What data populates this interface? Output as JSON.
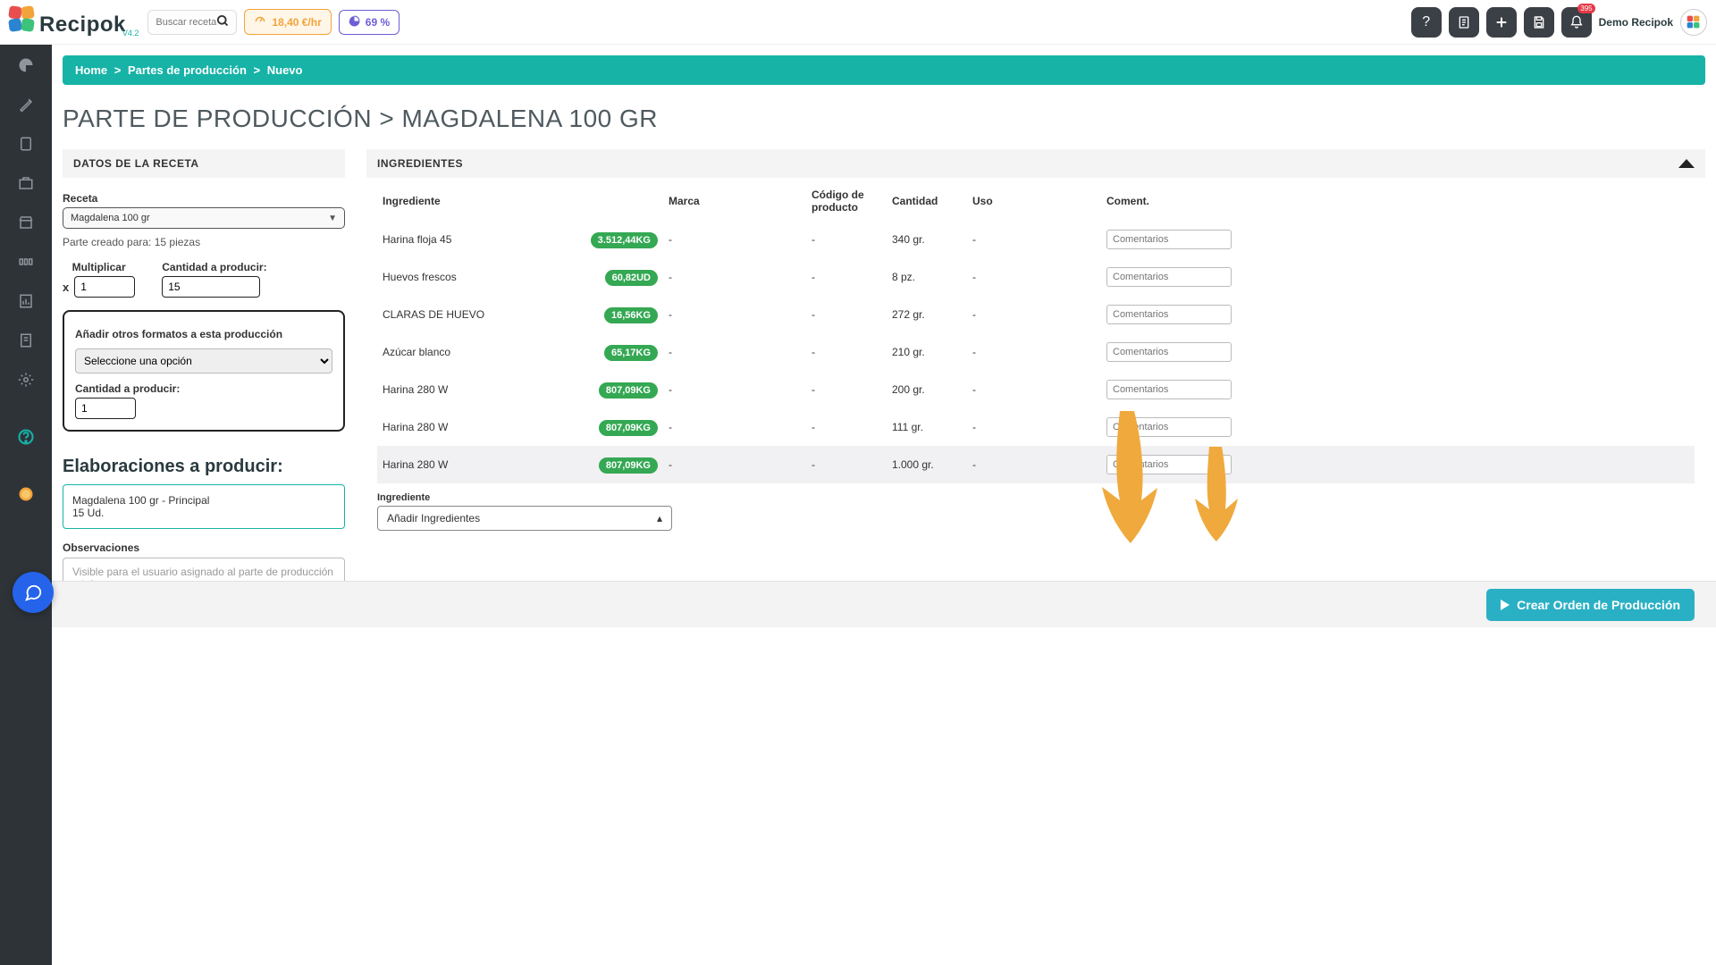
{
  "top": {
    "logo_text": "Recipok",
    "version": "V4.2",
    "search_placeholder": "Buscar recetas..",
    "metric_price": "18,40 €/hr",
    "metric_pct": "69 %",
    "notif_badge": "395",
    "user_name": "Demo Recipok"
  },
  "breadcrumb": {
    "home": "Home",
    "sep": ">",
    "partes": "Partes de producción",
    "nuevo": "Nuevo"
  },
  "page_title": "PARTE DE PRODUCCIÓN > MAGDALENA 100 GR",
  "recipe_panel": {
    "header": "DATOS DE LA RECETA",
    "recipe_label": "Receta",
    "recipe_value": "Magdalena 100 gr",
    "created_for": "Parte creado para: 15 piezas",
    "mult_label": "Multiplicar",
    "mult_value": "1",
    "qty_label": "Cantidad a producir:",
    "qty_value": "15",
    "addfmt_title": "Añadir otros formatos a esta producción",
    "addfmt_placeholder": "Seleccione una opción",
    "addfmt_qty_label": "Cantidad a producir:",
    "addfmt_qty_value": "1",
    "elab_header": "Elaboraciones a producir:",
    "elab_line1": "Magdalena 100 gr - Principal",
    "elab_line2": "15 Ud.",
    "obs_label": "Observaciones",
    "obs_placeholder": "Visible para el usuario asignado al parte de producción e informes"
  },
  "ingredients_panel": {
    "header": "INGREDIENTES",
    "cols": {
      "ingrediente": "Ingrediente",
      "marca": "Marca",
      "codigo": "Código de producto",
      "cantidad": "Cantidad",
      "uso": "Uso",
      "coment": "Coment."
    },
    "rows": [
      {
        "name": "Harina floja 45",
        "stock": "3.512,44KG",
        "marca": "-",
        "codigo": "-",
        "cant": "340 gr.",
        "uso": "-"
      },
      {
        "name": "Huevos frescos",
        "stock": "60,82UD",
        "marca": "-",
        "codigo": "-",
        "cant": "8 pz.",
        "uso": "-"
      },
      {
        "name": "CLARAS DE HUEVO",
        "stock": "16,56KG",
        "marca": "-",
        "codigo": "-",
        "cant": "272 gr.",
        "uso": "-"
      },
      {
        "name": "Azúcar blanco",
        "stock": "65,17KG",
        "marca": "-",
        "codigo": "-",
        "cant": "210 gr.",
        "uso": "-"
      },
      {
        "name": "Harina 280 W",
        "stock": "807,09KG",
        "marca": "-",
        "codigo": "-",
        "cant": "200 gr.",
        "uso": "-"
      },
      {
        "name": "Harina 280 W",
        "stock": "807,09KG",
        "marca": "-",
        "codigo": "-",
        "cant": "111 gr.",
        "uso": "-"
      },
      {
        "name": "Harina 280 W",
        "stock": "807,09KG",
        "marca": "-",
        "codigo": "-",
        "cant": "1.000 gr.",
        "uso": "-",
        "hl": true
      }
    ],
    "add_label": "Ingrediente",
    "add_placeholder": "Añadir Ingredientes",
    "comment_placeholder": "Comentarios"
  },
  "footer": {
    "create_btn": "Crear Orden de Producción"
  },
  "colors": {
    "teal": "#17b3a7",
    "green": "#34a853",
    "orange": "#f2a43b",
    "purple": "#6b5ed6",
    "cta": "#2ab0c4"
  }
}
